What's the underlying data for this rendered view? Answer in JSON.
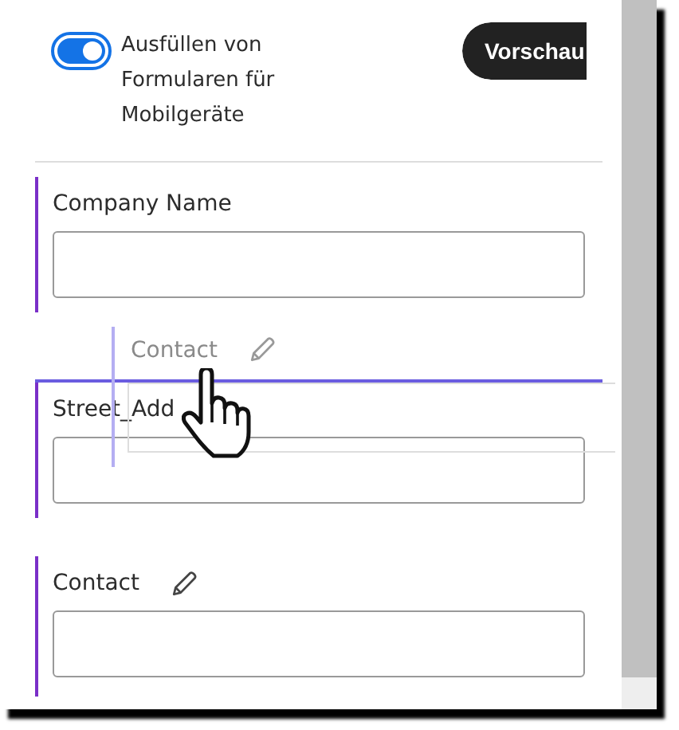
{
  "mobile_form_toggle": {
    "label": "Ausfüllen von Formularen für Mobilgeräte",
    "on": true
  },
  "preview_button": "Vorschau",
  "fields": [
    {
      "label": "Company Name",
      "editable": false
    },
    {
      "label": "Street_Add",
      "editable": false
    },
    {
      "label": "Contact",
      "editable": true
    }
  ],
  "drag_ghost": {
    "label": "Contact",
    "editable": true
  }
}
